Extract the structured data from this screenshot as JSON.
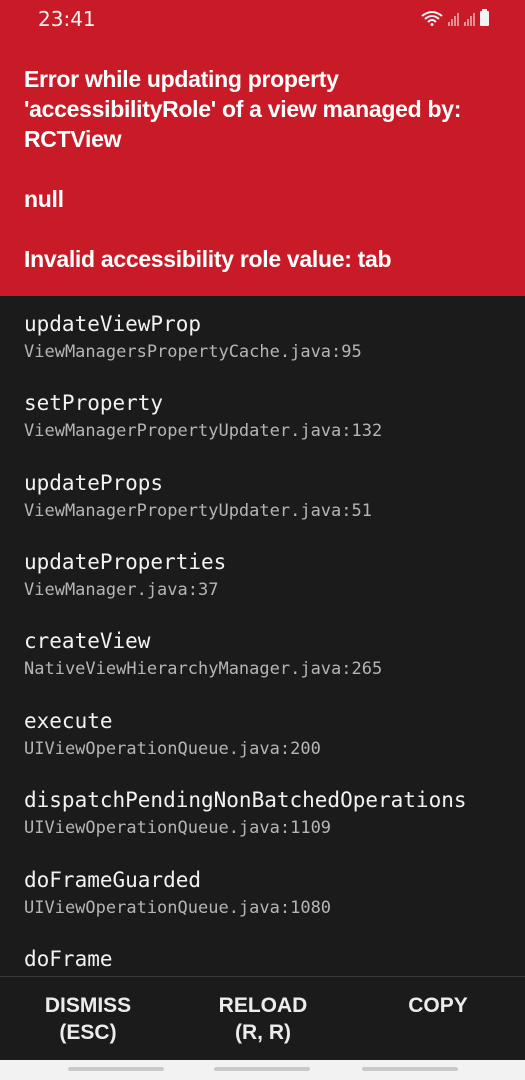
{
  "status_bar": {
    "time": "23:41",
    "icons": [
      "wifi-icon",
      "signal-icon",
      "signal-icon",
      "battery-icon"
    ]
  },
  "error": {
    "line1": "Error while updating property 'accessibilityRole' of a view managed by: RCTView",
    "line2": "null",
    "line3": "Invalid accessibility role value: tab"
  },
  "stack": [
    {
      "method": "updateViewProp",
      "file": "ViewManagersPropertyCache.java:95"
    },
    {
      "method": "setProperty",
      "file": "ViewManagerPropertyUpdater.java:132"
    },
    {
      "method": "updateProps",
      "file": "ViewManagerPropertyUpdater.java:51"
    },
    {
      "method": "updateProperties",
      "file": "ViewManager.java:37"
    },
    {
      "method": "createView",
      "file": "NativeViewHierarchyManager.java:265"
    },
    {
      "method": "execute",
      "file": "UIViewOperationQueue.java:200"
    },
    {
      "method": "dispatchPendingNonBatchedOperations",
      "file": "UIViewOperationQueue.java:1109"
    },
    {
      "method": "doFrameGuarded",
      "file": "UIViewOperationQueue.java:1080"
    },
    {
      "method": "doFrame",
      "file": ""
    }
  ],
  "footer": {
    "dismiss_line1": "DISMISS",
    "dismiss_line2": "(ESC)",
    "reload_line1": "RELOAD",
    "reload_line2": "(R, R)",
    "copy_label": "COPY"
  },
  "colors": {
    "header_red": "#c81b27",
    "background": "#1b1b1b"
  }
}
